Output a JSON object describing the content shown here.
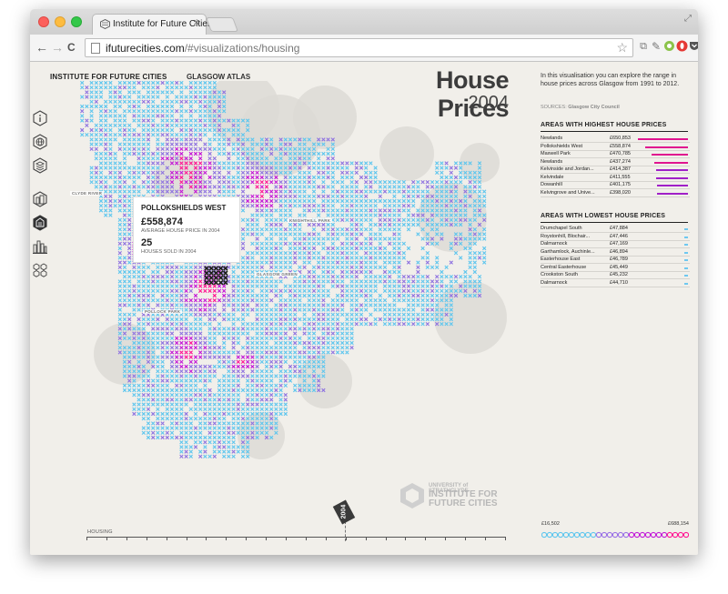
{
  "browser": {
    "tab_title": "Institute for Future Cities",
    "tab_close": "×",
    "url_domain": "ifuturecities.com",
    "url_path": "/#visualizations/housing",
    "back": "←",
    "forward": "→",
    "reload": "C",
    "bookmark_star": "☆",
    "menu": "≡"
  },
  "header": {
    "brand": "INSTITUTE FOR FUTURE CITIES",
    "atlas": "GLASGOW ATLAS",
    "title": "House Prices",
    "year": "2004"
  },
  "sidebar": {
    "icons": [
      "info-icon",
      "globe-icon",
      "layers-icon",
      "buildings-icon",
      "housing-icon",
      "city-icon",
      "people-icon"
    ],
    "active": "housing-icon"
  },
  "map": {
    "labels": {
      "clyde_river": "CLYDE RIVER",
      "knightswood": "KNIGHTSWOOD",
      "high_park": "BELLAHOUSTON PARK",
      "glasgow_green": "GLASGOW GREEN",
      "pollock_park": "POLLOCK PARK",
      "kelvin_park": "KNIGHTHILL PARK"
    },
    "tooltip": {
      "area": "POLLOKSHIELDS WEST",
      "price": "£558,874",
      "price_label": "AVERAGE HOUSE PRICE IN 2004",
      "houses": "25",
      "houses_label": "HOUSES SOLD IN 2004"
    },
    "colors": {
      "low": "#5ec6ee",
      "mid": "#8f73e0",
      "high": "#c418d6",
      "top": "#ff1493",
      "selected": "#1a1a1a"
    }
  },
  "university": {
    "line1": "UNIVERSITY of STRATHCLYDE",
    "line2": "INSTITUTE FOR FUTURE CITIES"
  },
  "timeline": {
    "label": "HOUSING",
    "marker": "2004",
    "position_fraction": 0.62
  },
  "panel": {
    "intro": "In this visualisation you can explore the range in house prices across Glasgow from 1991 to 2012.",
    "sources_label": "SOURCES:",
    "sources_value": "Glasgow City Council",
    "highest_title": "AREAS WITH HIGHEST HOUSE PRICES",
    "highest": [
      {
        "name": "Newlands",
        "price": "£650,853",
        "value": 650853
      },
      {
        "name": "Pollokshields West",
        "price": "£558,874",
        "value": 558874
      },
      {
        "name": "Maxwell Park",
        "price": "£470,785",
        "value": 470785
      },
      {
        "name": "Newlands",
        "price": "£437,274",
        "value": 437274
      },
      {
        "name": "Kelvinside and Jordan...",
        "price": "£414,387",
        "value": 414387
      },
      {
        "name": "Kelvindale",
        "price": "£411,555",
        "value": 411555
      },
      {
        "name": "Dowanhill",
        "price": "£401,175",
        "value": 401175
      },
      {
        "name": "Kelvingrove and Unive...",
        "price": "£398,020",
        "value": 398020
      }
    ],
    "lowest_title": "AREAS WITH LOWEST HOUSE PRICES",
    "lowest": [
      {
        "name": "Drumchapel South",
        "price": "£47,884",
        "value": 47884
      },
      {
        "name": "Roystonhill, Blochair...",
        "price": "£47,446",
        "value": 47446
      },
      {
        "name": "Dalmarnock",
        "price": "£47,169",
        "value": 47169
      },
      {
        "name": "Garthamlock, Auchinle...",
        "price": "£46,894",
        "value": 46894
      },
      {
        "name": "Easterhouse East",
        "price": "£46,789",
        "value": 46789
      },
      {
        "name": "Central Easterhouse",
        "price": "£45,449",
        "value": 45449
      },
      {
        "name": "Crookston South",
        "price": "£45,232",
        "value": 45232
      },
      {
        "name": "Dalmarnock",
        "price": "£44,710",
        "value": 44710
      }
    ],
    "scale_min": "£16,502",
    "scale_max": "£688,154",
    "scale_min_value": 16502,
    "scale_max_value": 688154
  }
}
